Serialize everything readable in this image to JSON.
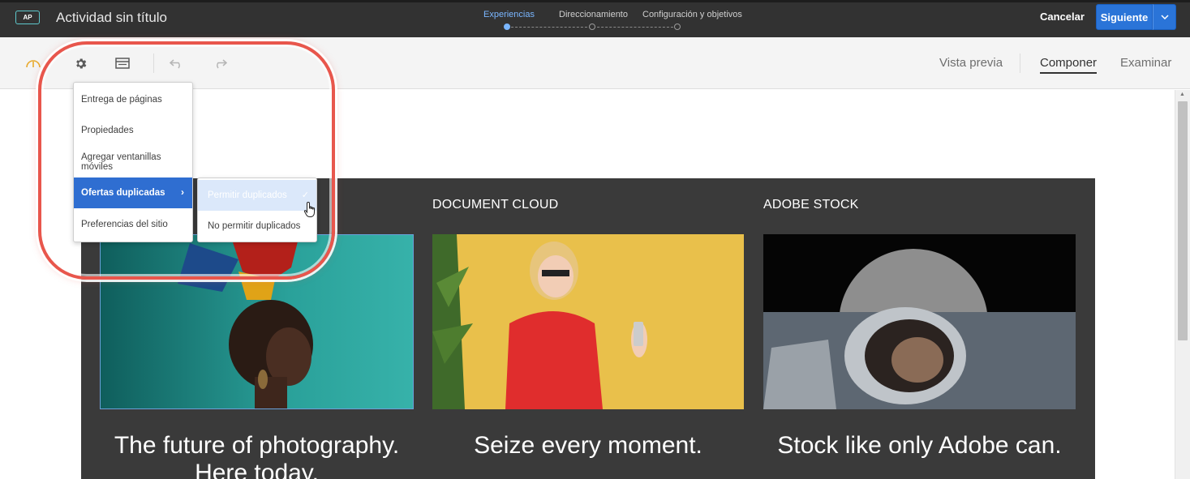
{
  "header": {
    "badge": "AP",
    "title": "Actividad sin título",
    "steps": [
      {
        "label": "Experiencias",
        "active": true
      },
      {
        "label": "Direccionamiento",
        "active": false
      },
      {
        "label": "Configuración y objetivos",
        "active": false
      }
    ],
    "cancel_label": "Cancelar",
    "next_label": "Siguiente",
    "next_dropdown_icon": "chevron-down-icon"
  },
  "toolbar": {
    "icons": [
      "gauge-icon",
      "gear-icon",
      "layout-icon",
      "undo-icon",
      "redo-icon"
    ],
    "views": [
      {
        "label": "Vista previa",
        "active": false
      },
      {
        "label": "Componer",
        "active": true
      },
      {
        "label": "Examinar",
        "active": false
      }
    ]
  },
  "menu": {
    "items": [
      {
        "label": "Entrega de páginas"
      },
      {
        "label": "Propiedades"
      },
      {
        "label": "Agregar ventanillas móviles"
      },
      {
        "label": "Ofertas duplicadas",
        "active": true,
        "has_submenu": true
      },
      {
        "label": "Preferencias del sitio"
      }
    ],
    "submenu": [
      {
        "label": "Permitir duplicados",
        "checked": true
      },
      {
        "label": "No permitir duplicados"
      }
    ]
  },
  "page": {
    "columns": [
      {
        "heading": "",
        "tagline_line1": "The future of photography.",
        "tagline_line2": "Here today."
      },
      {
        "heading": "DOCUMENT CLOUD",
        "tagline_line1": "Seize every moment.",
        "tagline_line2": ""
      },
      {
        "heading": "ADOBE STOCK",
        "tagline_line1": "Stock like only Adobe can.",
        "tagline_line2": ""
      }
    ]
  },
  "colors": {
    "header_bg": "#323232",
    "accent_blue": "#2a74d8",
    "active_step": "#7ab6ff",
    "highlight_ring": "#e8564c",
    "panel_bg": "#3a3a3a"
  }
}
